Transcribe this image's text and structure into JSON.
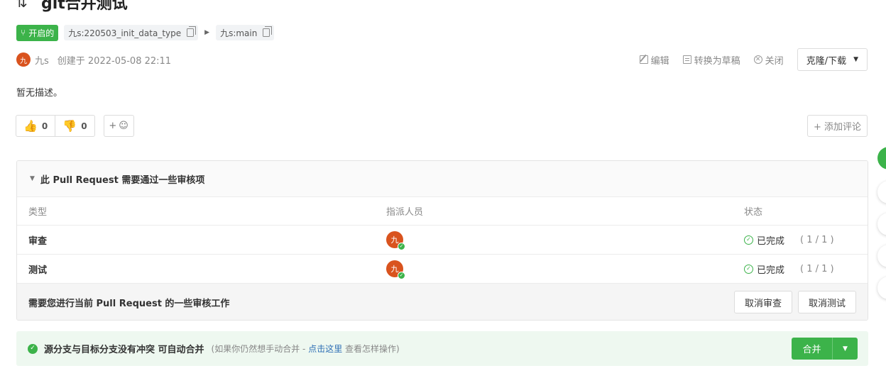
{
  "header": {
    "pr_icon": "git-pull-request-icon",
    "title": "git合并测试"
  },
  "branches": {
    "status": "开启的",
    "source": "九s:220503_init_data_type",
    "target": "九s:main"
  },
  "meta": {
    "avatar_initial": "九",
    "author": "九s",
    "created": "创建于 2022-05-08 22:11"
  },
  "actions": {
    "edit": "编辑",
    "to_draft": "转换为草稿",
    "close": "关闭",
    "clone": "克隆/下载"
  },
  "description": "暂无描述。",
  "reactions": {
    "thumbs_up": "0",
    "thumbs_down": "0",
    "emoji_plus": "+",
    "add_comment": "+ 添加评论"
  },
  "review": {
    "heading": "此 Pull Request 需要通过一些审核项",
    "columns": [
      "类型",
      "指派人员",
      "状态"
    ],
    "rows": [
      {
        "type": "审查",
        "assignee": "九",
        "status": "已完成",
        "progress": "( 1 / 1 )"
      },
      {
        "type": "测试",
        "assignee": "九",
        "status": "已完成",
        "progress": "( 1 / 1 )"
      }
    ],
    "footer_text": "需要您进行当前 Pull Request 的一些审核工作",
    "cancel_review": "取消审查",
    "cancel_test": "取消测试"
  },
  "merge": {
    "message": "源分支与目标分支没有冲突 可自动合并",
    "hint_prefix": "(如果你仍然想手动合并 - ",
    "hint_link": "点击这里",
    "hint_suffix": " 查看怎样操作)",
    "button": "合并"
  },
  "colors": {
    "accent_green": "#3cb34a",
    "avatar": "#d9531e",
    "link": "#2f6fb5"
  }
}
